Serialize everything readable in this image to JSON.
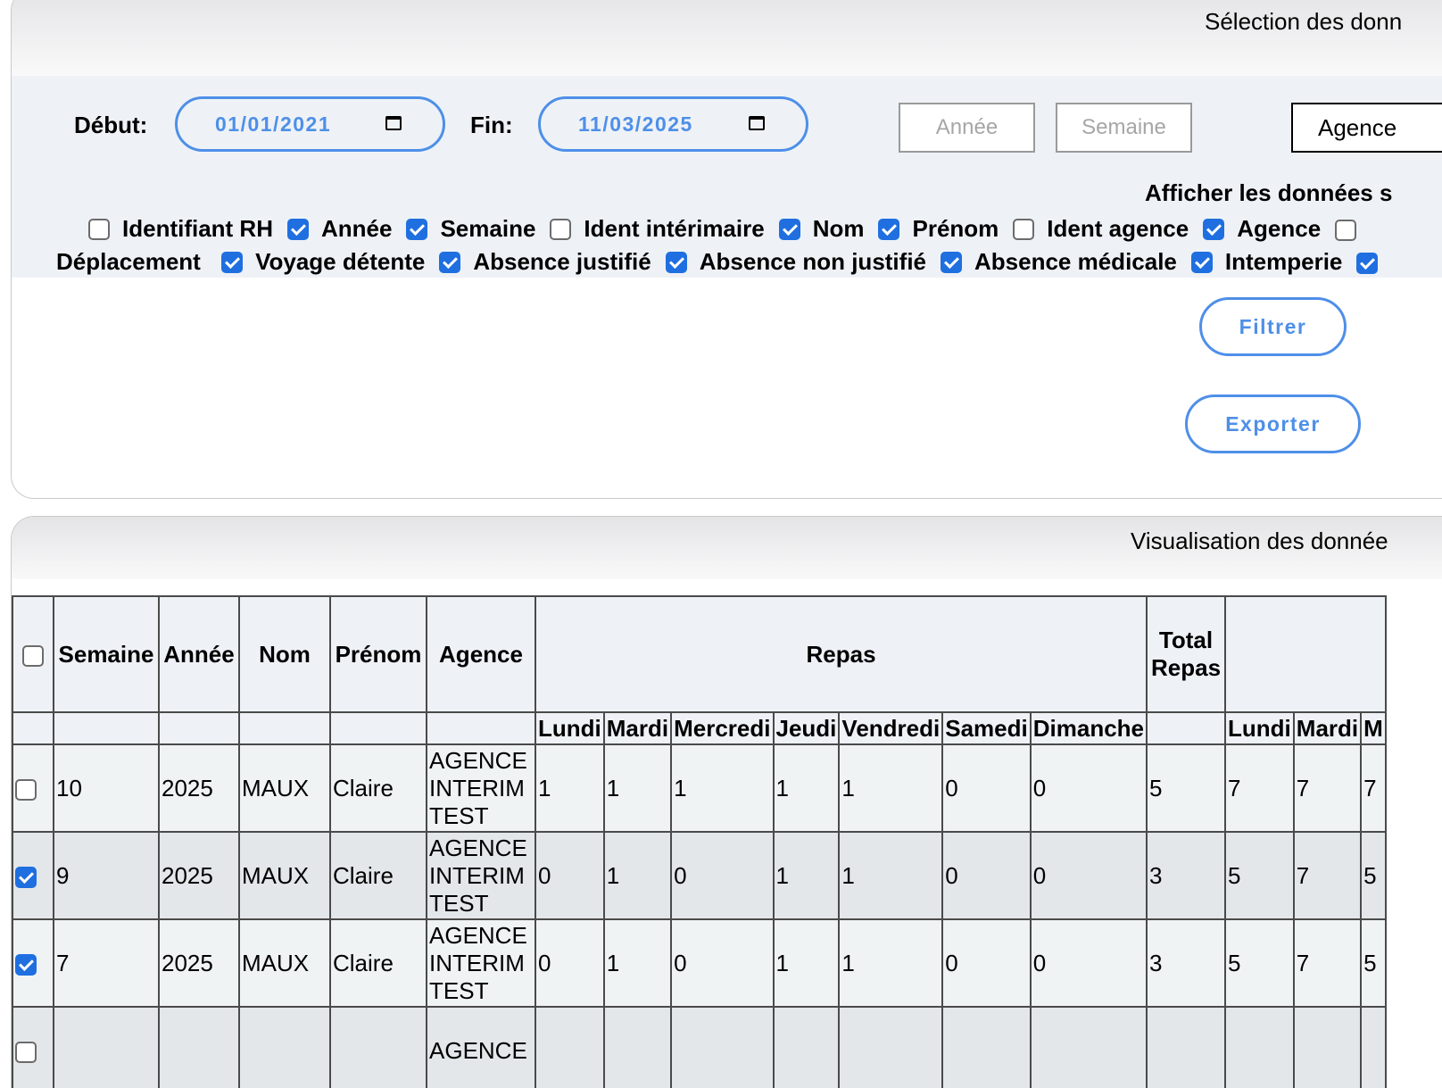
{
  "selection": {
    "title": "Sélection des donn",
    "debut_label": "Début:",
    "debut_value": "01/01/2021",
    "fin_label": "Fin:",
    "fin_value": "11/03/2025",
    "btn_annee": "Année",
    "btn_semaine": "Semaine",
    "btn_agence": "Agence",
    "afficher_label": "Afficher les données s",
    "checkboxes_row1": [
      {
        "label": "Identifiant RH",
        "checked": false
      },
      {
        "label": "Année",
        "checked": true
      },
      {
        "label": "Semaine",
        "checked": true
      },
      {
        "label": "Ident intérimaire",
        "checked": false
      },
      {
        "label": "Nom",
        "checked": true
      },
      {
        "label": "Prénom",
        "checked": true
      },
      {
        "label": "Ident agence",
        "checked": false
      },
      {
        "label": "Agence",
        "checked": true
      },
      {
        "label": "",
        "checked": false
      }
    ],
    "checkboxes_row2_lead": "Déplacement",
    "checkboxes_row2": [
      {
        "label": "Voyage détente",
        "checked": true
      },
      {
        "label": "Absence justifié",
        "checked": true
      },
      {
        "label": "Absence non justifié",
        "checked": true
      },
      {
        "label": "Absence médicale",
        "checked": true
      },
      {
        "label": "Intemperie",
        "checked": true
      },
      {
        "label": "",
        "checked": true
      }
    ],
    "filtrer": "Filtrer",
    "exporter": "Exporter"
  },
  "visualisation": {
    "title": "Visualisation des donnée",
    "headers": {
      "semaine": "Semaine",
      "annee": "Année",
      "nom": "Nom",
      "prenom": "Prénom",
      "agence": "Agence",
      "repas": "Repas",
      "total_repas": "Total Repas",
      "days": [
        "Lundi",
        "Mardi",
        "Mercredi",
        "Jeudi",
        "Vendredi",
        "Samedi",
        "Dimanche"
      ],
      "days2": [
        "Lundi",
        "Mardi",
        "M"
      ]
    },
    "rows": [
      {
        "checked": false,
        "semaine": "10",
        "annee": "2025",
        "nom": "MAUX",
        "prenom": "Claire",
        "agence": [
          "AGENCE",
          "INTERIM",
          "TEST"
        ],
        "repas": [
          "1",
          "1",
          "1",
          "1",
          "1",
          "0",
          "0"
        ],
        "total": "5",
        "next": [
          "7",
          "7",
          "7"
        ]
      },
      {
        "checked": true,
        "semaine": "9",
        "annee": "2025",
        "nom": "MAUX",
        "prenom": "Claire",
        "agence": [
          "AGENCE",
          "INTERIM",
          "TEST"
        ],
        "repas": [
          "0",
          "1",
          "0",
          "1",
          "1",
          "0",
          "0"
        ],
        "total": "3",
        "next": [
          "5",
          "7",
          "5"
        ]
      },
      {
        "checked": true,
        "semaine": "7",
        "annee": "2025",
        "nom": "MAUX",
        "prenom": "Claire",
        "agence": [
          "AGENCE",
          "INTERIM",
          "TEST"
        ],
        "repas": [
          "0",
          "1",
          "0",
          "1",
          "1",
          "0",
          "0"
        ],
        "total": "3",
        "next": [
          "5",
          "7",
          "5"
        ]
      },
      {
        "checked": false,
        "semaine": "",
        "annee": "",
        "nom": "",
        "prenom": "",
        "agence": [
          "AGENCE",
          "",
          ""
        ],
        "repas": [
          "",
          "",
          "",
          "",
          "",
          "",
          ""
        ],
        "total": "",
        "next": [
          "",
          "",
          ""
        ]
      }
    ]
  }
}
